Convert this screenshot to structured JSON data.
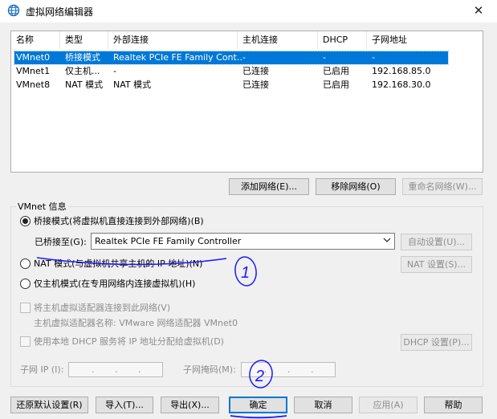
{
  "window": {
    "title": "虚拟网络编辑器",
    "close_glyph": "✕"
  },
  "list": {
    "columns": [
      "名称",
      "类型",
      "外部连接",
      "主机连接",
      "DHCP",
      "子网地址"
    ],
    "rows": [
      [
        "VMnet0",
        "桥接模式",
        "Realtek PCIe FE Family Cont...",
        "-",
        "-",
        "-"
      ],
      [
        "VMnet1",
        "仅主机...",
        "-",
        "已连接",
        "已启用",
        "192.168.85.0"
      ],
      [
        "VMnet8",
        "NAT 模式",
        "NAT 模式",
        "已连接",
        "已启用",
        "192.168.30.0"
      ]
    ],
    "selected_index": 0
  },
  "list_buttons": {
    "add": "添加网络(E)...",
    "remove": "移除网络(O)",
    "rename": "重命名网络(W)..."
  },
  "vmnet_info": {
    "group_label": "VMnet 信息",
    "bridged_label": "桥接模式(将虚拟机直接连接到外部网络)(B)",
    "bridged_to_label": "已桥接至(G):",
    "bridged_to_value": "Realtek PCIe FE Family Controller",
    "auto_settings": "自动设置(U)...",
    "nat_label": "NAT 模式(与虚拟机共享主机的 IP 地址)(N)",
    "nat_settings": "NAT 设置(S)...",
    "hostonly_label": "仅主机模式(在专用网络内连接虚拟机)(H)",
    "connect_adapter_label": "将主机虚拟适配器连接到此网络(V)",
    "adapter_name_label": "主机虚拟适配器名称: VMware 网络适配器 VMnet0",
    "dhcp_label": "使用本地 DHCP 服务将 IP 地址分配给虚拟机(D)",
    "dhcp_settings": "DHCP 设置(P)...",
    "subnet_ip_label": "子网 IP (I):",
    "subnet_ip_value": ". . .",
    "subnet_mask_label": "子网掩码(M):",
    "subnet_mask_value": ". . ."
  },
  "bottom_buttons": {
    "restore": "还原默认设置(R)",
    "import": "导入(T)...",
    "export": "导出(X)...",
    "ok": "确定",
    "cancel": "取消",
    "apply": "应用(A)",
    "help": "帮助"
  },
  "annotations": {
    "mark1": "1",
    "mark2": "2",
    "ink_color": "#1a1aff"
  },
  "colors": {
    "selection": "#0078d7",
    "dialog_bg": "#f0f0f0"
  }
}
